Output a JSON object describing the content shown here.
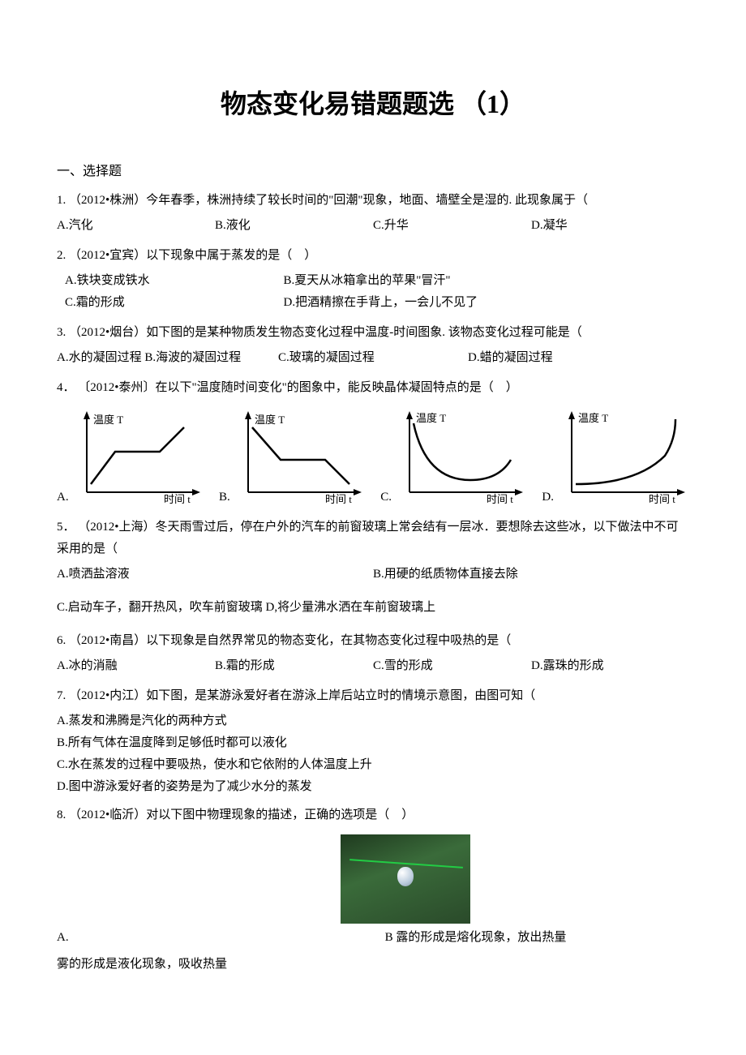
{
  "title": "物态变化易错题题选 （1）",
  "section": "一、选择题",
  "q1": {
    "num": "1.",
    "stem": "（2012•株洲）今年春季，株洲持续了较长时间的\"回潮\"现象，地面、墙壁全是湿的. 此现象属于（",
    "A": "A.汽化",
    "B": "B.液化",
    "C": "C.升华",
    "D": "D.凝华"
  },
  "q2": {
    "num": "2.",
    "stem": "（2012•宜宾）以下现象中属于蒸发的是（　）",
    "A": "A.铁块变成铁水",
    "B": "B.夏天从冰箱拿出的苹果\"冒汗\"",
    "C": "C.霜的形成",
    "D": "D.把酒精擦在手背上，一会儿不见了"
  },
  "q3": {
    "num": "3.",
    "stem": "（2012•烟台）如下图的是某种物质发生物态变化过程中温度-时间图象. 该物态变化过程可能是（",
    "A": "A.水的凝固过程",
    "B": "B.海波的凝固过程",
    "C": "C.玻璃的凝固过程",
    "D": "D.蜡的凝固过程"
  },
  "q4": {
    "num": "4．",
    "stem": "〔2012•泰州〕在以下\"温度随时间变化\"的图象中，能反映晶体凝固特点的是（　）"
  },
  "chart_labels": {
    "ylabel": "温度 T",
    "xlabel": "时间  t",
    "A": "A.",
    "B": "B.",
    "C": "C.",
    "D": "D."
  },
  "chart_data": [
    {
      "type": "line",
      "desc": "rise-plateau-rise",
      "xlabel": "时间 t",
      "ylabel": "温度 T"
    },
    {
      "type": "line",
      "desc": "fall-plateau-fall",
      "xlabel": "时间 t",
      "ylabel": "温度 T"
    },
    {
      "type": "line",
      "desc": "concave-decay-then-rise",
      "xlabel": "时间 t",
      "ylabel": "温度 T"
    },
    {
      "type": "line",
      "desc": "concave-up sharp rise",
      "xlabel": "时间 t",
      "ylabel": "温度 T"
    }
  ],
  "q5": {
    "num": "5．",
    "stem": "（2012•上海）冬天雨雪过后，停在户外的汽车的前窗玻璃上常会结有一层冰．要想除去这些冰，以下做法中不可采用的是（",
    "A": "A.喷洒盐溶液",
    "B": "B.用硬的纸质物体直接去除",
    "C": "C.启动车子，翻开热风，吹车前窗玻璃",
    "D": "D,将少量沸水洒在车前窗玻璃上"
  },
  "q6": {
    "num": "6.",
    "stem": "（2012•南昌）以下现象是自然界常见的物态变化，在其物态变化过程中吸热的是（",
    "A": "A.冰的消融",
    "B": "B.霜的形成",
    "C": "C.雪的形成",
    "D": "D.露珠的形成"
  },
  "q7": {
    "num": "7.",
    "stem": "（2012•内江）如下图，是某游泳爱好者在游泳上岸后站立时的情境示意图，由图可知（",
    "A": "A.蒸发和沸腾是汽化的两种方式",
    "B": "B.所有气体在温度降到足够低时都可以液化",
    "C": "C.水在蒸发的过程中要吸热，使水和它依附的人体温度上升",
    "D": "D.图中游泳爱好者的姿势是为了减少水分的蒸发"
  },
  "q8": {
    "num": "8.",
    "stem": "（2012•临沂）对以下图中物理现象的描述，正确的选项是（　）",
    "A": "A.",
    "B": "B 露的形成是熔化现象，放出热量",
    "Atext": "雾的形成是液化现象，吸收热量"
  }
}
